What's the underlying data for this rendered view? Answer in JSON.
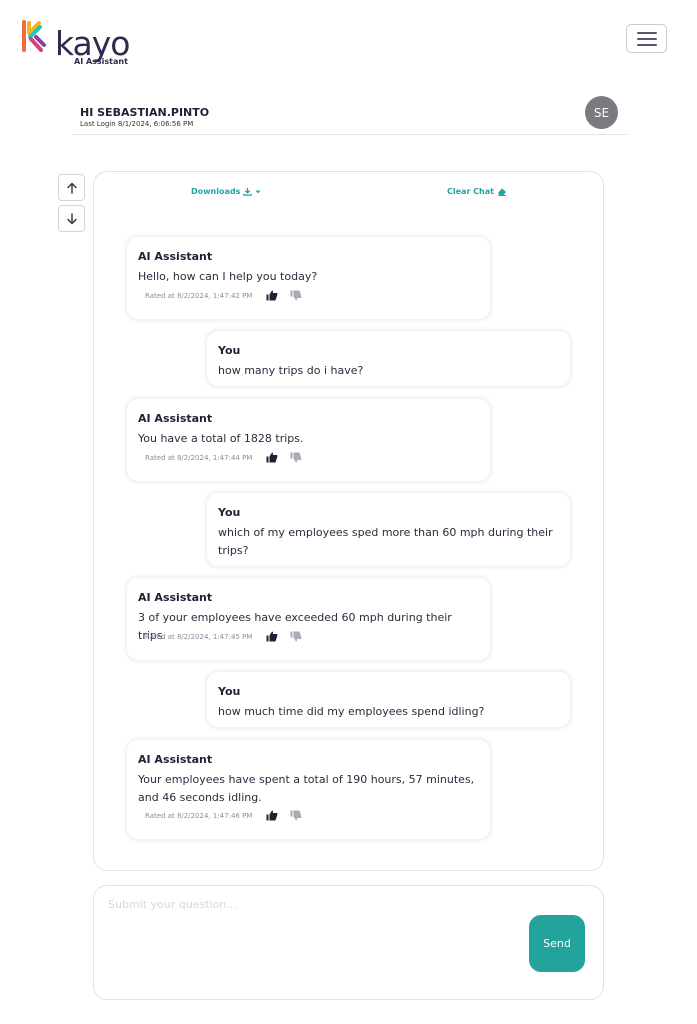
{
  "brand": {
    "name": "kayo",
    "subtitle": "AI Assistant"
  },
  "header": {
    "greeting": "HI SEBASTIAN.PINTO",
    "last_login": "Last Login 8/1/2024, 6:06:56 PM",
    "avatar_initials": "SE"
  },
  "toolbar": {
    "downloads_label": "Downloads",
    "clear_label": "Clear Chat"
  },
  "messages": [
    {
      "sender": "AI Assistant",
      "text": "Hello, how can I help you today?",
      "rated": "Rated at 8/2/2024, 1:47:42 PM",
      "liked": true
    },
    {
      "sender": "You",
      "text": "how many trips do i have?"
    },
    {
      "sender": "AI Assistant",
      "text": "You have a total of 1828 trips.",
      "rated": "Rated at 8/2/2024, 1:47:44 PM",
      "liked": true
    },
    {
      "sender": "You",
      "text": "which of my employees sped more than 60 mph during their trips?"
    },
    {
      "sender": "AI Assistant",
      "text": "3 of your employees have exceeded 60 mph during their trips.",
      "rated": "Rated at 8/2/2024, 1:47:45 PM",
      "liked": true
    },
    {
      "sender": "You",
      "text": "how much time did my employees spend idling?"
    },
    {
      "sender": "AI Assistant",
      "text": "Your employees have spent a total of 190 hours, 57 minutes, and 46 seconds idling.",
      "rated": "Rated at 8/2/2024, 1:47:46 PM",
      "liked": true
    }
  ],
  "input": {
    "placeholder": "Submit your question...",
    "value": ""
  },
  "send_label": "Send",
  "colors": {
    "accent": "#22a39c",
    "text": "#1f2235",
    "thumb_active": "#1f2235",
    "thumb_inactive": "#a9abb5"
  }
}
